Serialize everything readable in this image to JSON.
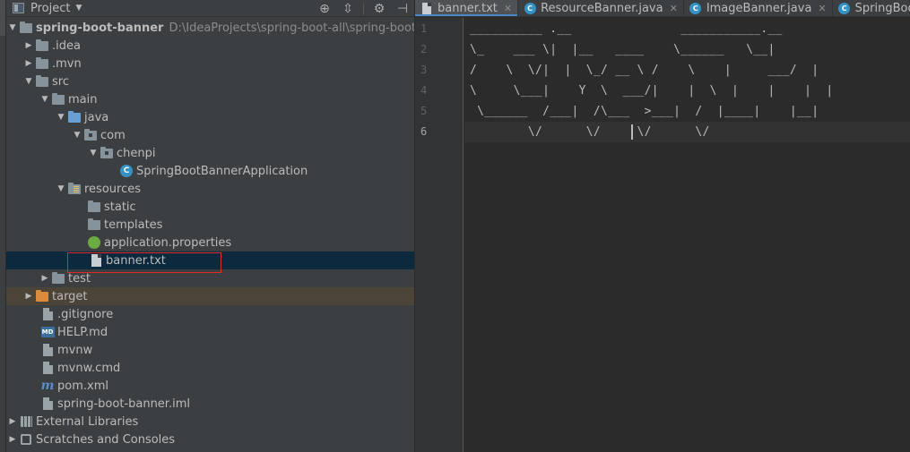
{
  "panel": {
    "title": "Project",
    "tools": [
      "crosshair-icon",
      "collapse-icon",
      "gear-icon",
      "hide-icon"
    ]
  },
  "tree": [
    {
      "label": "spring-boot-banner",
      "path": "D:\\IdeaProjects\\spring-boot-all\\spring-boot-bann",
      "icon": "module-folder-icon",
      "expanded": true
    },
    {
      "label": ".idea",
      "icon": "folder-icon",
      "expanded": false
    },
    {
      "label": ".mvn",
      "icon": "folder-icon",
      "expanded": false
    },
    {
      "label": "src",
      "icon": "folder-icon",
      "expanded": true
    },
    {
      "label": "main",
      "icon": "folder-icon",
      "expanded": true
    },
    {
      "label": "java",
      "icon": "source-folder-icon",
      "expanded": true
    },
    {
      "label": "com",
      "icon": "package-icon",
      "expanded": true
    },
    {
      "label": "chenpi",
      "icon": "package-icon",
      "expanded": true
    },
    {
      "label": "SpringBootBannerApplication",
      "icon": "spring-class-icon"
    },
    {
      "label": "resources",
      "icon": "resources-folder-icon",
      "expanded": true
    },
    {
      "label": "static",
      "icon": "folder-icon"
    },
    {
      "label": "templates",
      "icon": "folder-icon"
    },
    {
      "label": "application.properties",
      "icon": "properties-file-icon"
    },
    {
      "label": "banner.txt",
      "icon": "text-file-icon",
      "selected": true
    },
    {
      "label": "test",
      "icon": "folder-icon",
      "expanded": false
    },
    {
      "label": "target",
      "icon": "excluded-folder-icon",
      "expanded": false
    },
    {
      "label": ".gitignore",
      "icon": "file-icon"
    },
    {
      "label": "HELP.md",
      "icon": "markdown-file-icon"
    },
    {
      "label": "mvnw",
      "icon": "file-icon"
    },
    {
      "label": "mvnw.cmd",
      "icon": "file-icon"
    },
    {
      "label": "pom.xml",
      "icon": "maven-icon"
    },
    {
      "label": "spring-boot-banner.iml",
      "icon": "iml-file-icon"
    },
    {
      "label": "External Libraries",
      "icon": "library-icon",
      "expanded": false
    },
    {
      "label": "Scratches and Consoles",
      "icon": "scratch-icon",
      "expanded": false
    }
  ],
  "tabs": [
    {
      "label": "banner.txt",
      "icon": "text-file-icon",
      "active": true
    },
    {
      "label": "ResourceBanner.java",
      "icon": "class-icon"
    },
    {
      "label": "ImageBanner.java",
      "icon": "class-icon"
    },
    {
      "label": "SpringBootBann",
      "icon": "spring-class-icon"
    }
  ],
  "editor": {
    "line_numbers": [
      "1",
      "2",
      "3",
      "4",
      "5",
      "6"
    ],
    "current_line": 6,
    "lines": [
      "__________ .__               ___________.__",
      "\\_    ___ \\|  |__   ____    \\______   \\__|",
      "/    \\  \\/|  |  \\_/ __ \\ /    \\    |     ___/  |",
      "\\     \\___|    Y  \\  ___/|    |  \\  |    |    |  |",
      " \\______  /___|  /\\___  >___|  /  |____|    |__|",
      "        \\/      \\/     \\/      \\/"
    ]
  },
  "colors": {
    "panel_bg": "#3c3f41",
    "editor_bg": "#2b2b2b",
    "selected_row": "#0d293e",
    "excluded_row": "#4b4437",
    "highlight_border": "#e02828",
    "active_tab_underline": "#4a88c7"
  }
}
